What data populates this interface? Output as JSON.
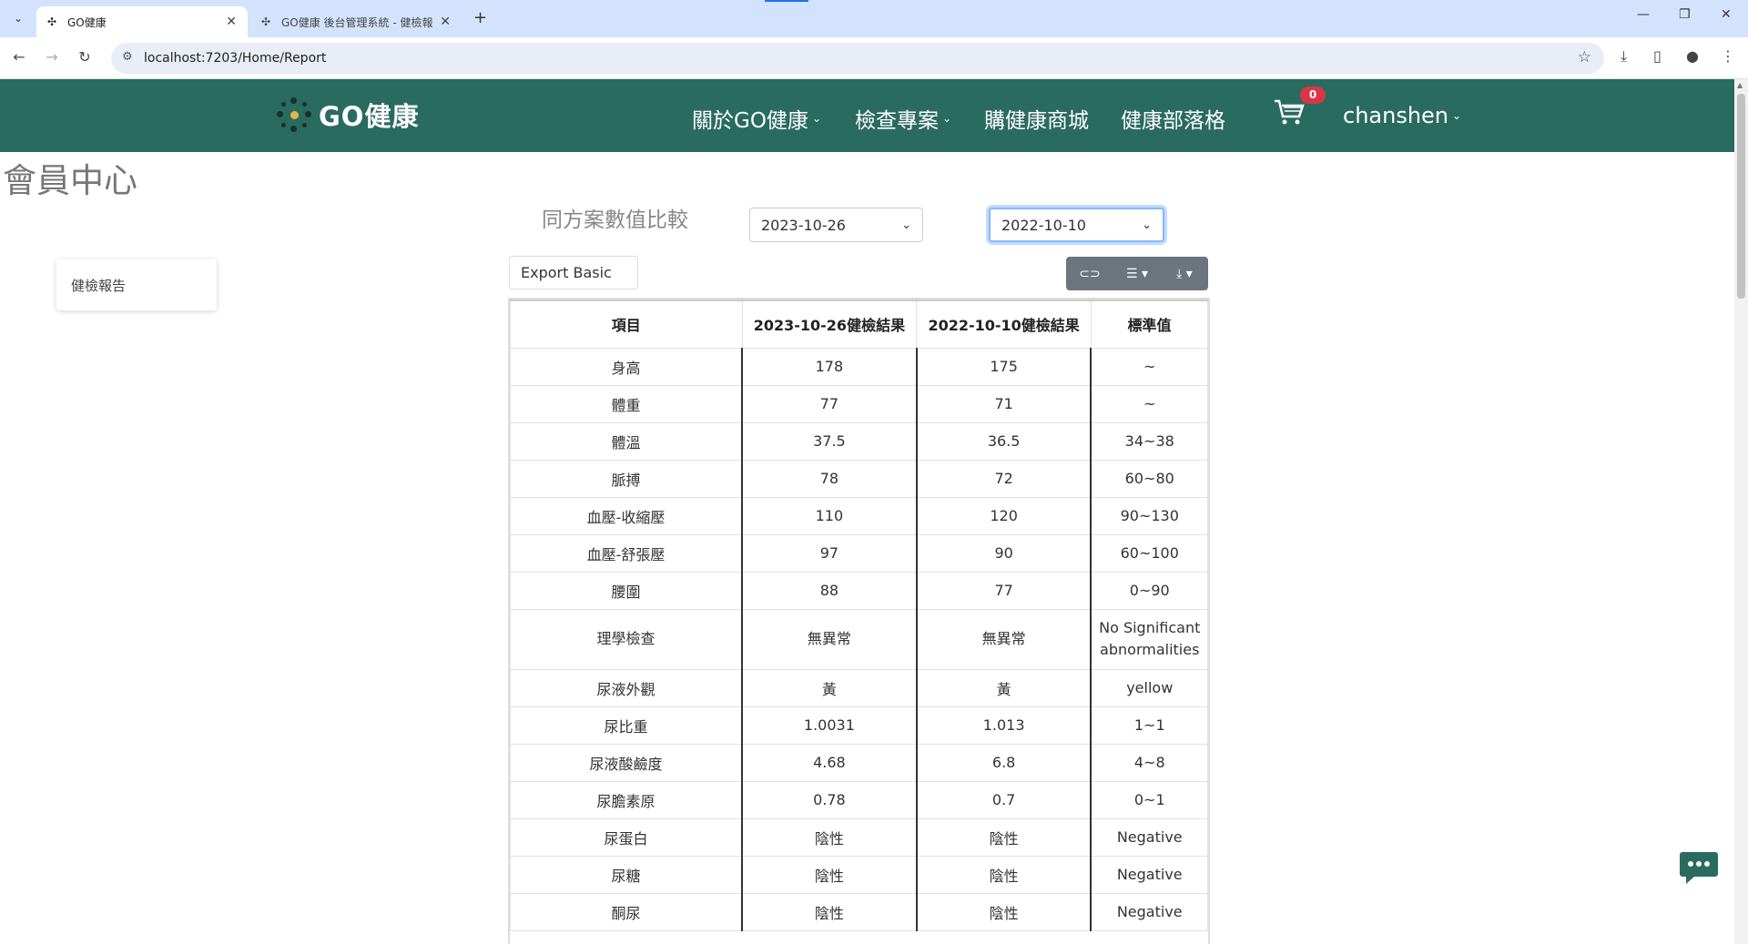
{
  "browser": {
    "tabs": [
      {
        "title": "GO健康",
        "active": true
      },
      {
        "title": "GO健康 後台管理系統 - 健檢報",
        "active": false
      }
    ],
    "url": "localhost:7203/Home/Report"
  },
  "site": {
    "logo_text": "GO健康",
    "nav": [
      {
        "label": "關於GO健康",
        "dropdown": true
      },
      {
        "label": "檢查專案",
        "dropdown": true
      },
      {
        "label": "購健康商城",
        "dropdown": false
      },
      {
        "label": "健康部落格",
        "dropdown": false
      }
    ],
    "cart_count": "0",
    "username": "chanshen",
    "header_color": "#2a6b5f"
  },
  "page": {
    "title": "會員中心",
    "sidebar_item": "健檢報告",
    "compare_label": "同方案數值比較",
    "date1": "2023-10-26",
    "date2": "2022-10-10",
    "export_label": "Export Basic"
  },
  "table": {
    "headers": [
      "項目",
      "2023-10-26健檢結果",
      "2022-10-10健檢結果",
      "標準值"
    ],
    "rows": [
      [
        "身高",
        "178",
        "175",
        "~"
      ],
      [
        "體重",
        "77",
        "71",
        "~"
      ],
      [
        "體溫",
        "37.5",
        "36.5",
        "34~38"
      ],
      [
        "脈搏",
        "78",
        "72",
        "60~80"
      ],
      [
        "血壓-收縮壓",
        "110",
        "120",
        "90~130"
      ],
      [
        "血壓-舒張壓",
        "97",
        "90",
        "60~100"
      ],
      [
        "腰圍",
        "88",
        "77",
        "0~90"
      ],
      [
        "理學檢查",
        "無異常",
        "無異常",
        "No Significant abnormalities"
      ],
      [
        "尿液外觀",
        "黃",
        "黃",
        "yellow"
      ],
      [
        "尿比重",
        "1.0031",
        "1.013",
        "1~1"
      ],
      [
        "尿液酸鹼度",
        "4.68",
        "6.8",
        "4~8"
      ],
      [
        "尿膽素原",
        "0.78",
        "0.7",
        "0~1"
      ],
      [
        "尿蛋白",
        "陰性",
        "陰性",
        "Negative"
      ],
      [
        "尿糖",
        "陰性",
        "陰性",
        "Negative"
      ],
      [
        "酮尿",
        "陰性",
        "陰性",
        "Negative"
      ]
    ]
  }
}
